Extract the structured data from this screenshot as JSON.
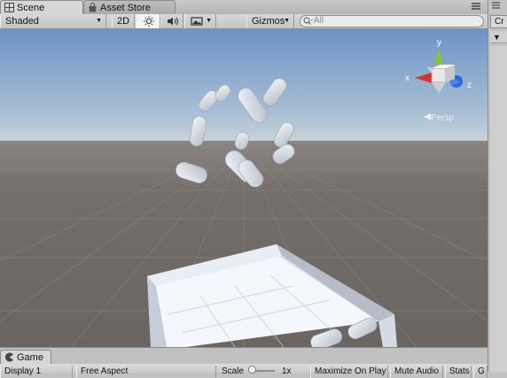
{
  "scene_tabs": {
    "scene": "Scene",
    "asset_store": "Asset Store",
    "menu_icon": "menu-lines-icon"
  },
  "scene_toolbar": {
    "shading_mode": "Shaded",
    "mode_2d": "2D",
    "lighting_icon": "sun-icon",
    "audio_icon": "speaker-icon",
    "effects_icon": "image-icon",
    "gizmos": "Gizmos",
    "search_placeholder": "All"
  },
  "gizmo": {
    "x": "x",
    "y": "y",
    "z": "z",
    "projection": "Persp"
  },
  "right_panel": {
    "tab": "Cr",
    "search": "Cr"
  },
  "game_panel": {
    "tab": "Game",
    "display": "Display 1",
    "aspect": "Free Aspect",
    "scale_label": "Scale",
    "scale_value": "1x",
    "maximize": "Maximize On Play",
    "mute": "Mute Audio",
    "stats": "Stats",
    "gizmos": "G"
  },
  "colors": {
    "sky_top": "#6d96c6",
    "sky_horizon": "#c9d3dc",
    "ground": "#6e6864",
    "object": "#dfe3ec",
    "axis_x": "#d8322a",
    "axis_y": "#8ac43d",
    "axis_z": "#2c66e0"
  }
}
